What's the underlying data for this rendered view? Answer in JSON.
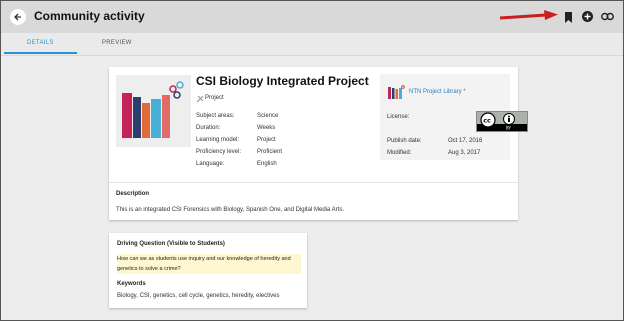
{
  "header": {
    "title": "Community activity",
    "icons": [
      "arrow-back-icon",
      "bookmark-icon",
      "add-circle-icon",
      "link-icon"
    ],
    "tooltip": "Bookmark"
  },
  "tabs": [
    {
      "label": "DETAILS",
      "selected": true
    },
    {
      "label": "PREVIEW",
      "selected": false
    }
  ],
  "project": {
    "title": "CSI Biology Integrated Project",
    "type": "Project",
    "fields": [
      {
        "label": "Subject areas:",
        "value": "Science"
      },
      {
        "label": "Duration:",
        "value": "Weeks"
      },
      {
        "label": "Learning model:",
        "value": "Project"
      },
      {
        "label": "Proficiency level:",
        "value": "Proficient"
      },
      {
        "label": "Language:",
        "value": "English"
      }
    ]
  },
  "library": {
    "name": "NTN Project Library *",
    "license_label": "License:",
    "publish_label": "Publish date:",
    "publish_date": "Oct 17, 2016",
    "modified_label": "Modified:",
    "modified_date": "Aug 3, 2017"
  },
  "description": {
    "heading": "Description",
    "text": "This is an integrated CSI Forensics with Biology, Spanish One, and Digital Media Arts."
  },
  "driving": {
    "heading": "Driving Question (Visible to Students)",
    "line1": "How can we as students use inquiry and our knowledge of heredity and",
    "line2": "genetics to solve a crime?"
  },
  "keywords": {
    "heading": "Keywords",
    "text": "Biology, CSI, genetics, cell cycle, genetics, heredity, electives"
  },
  "colors": {
    "accent": "#2a93d6",
    "arrow": "#c8201f",
    "highlight": "#fff7cf"
  }
}
